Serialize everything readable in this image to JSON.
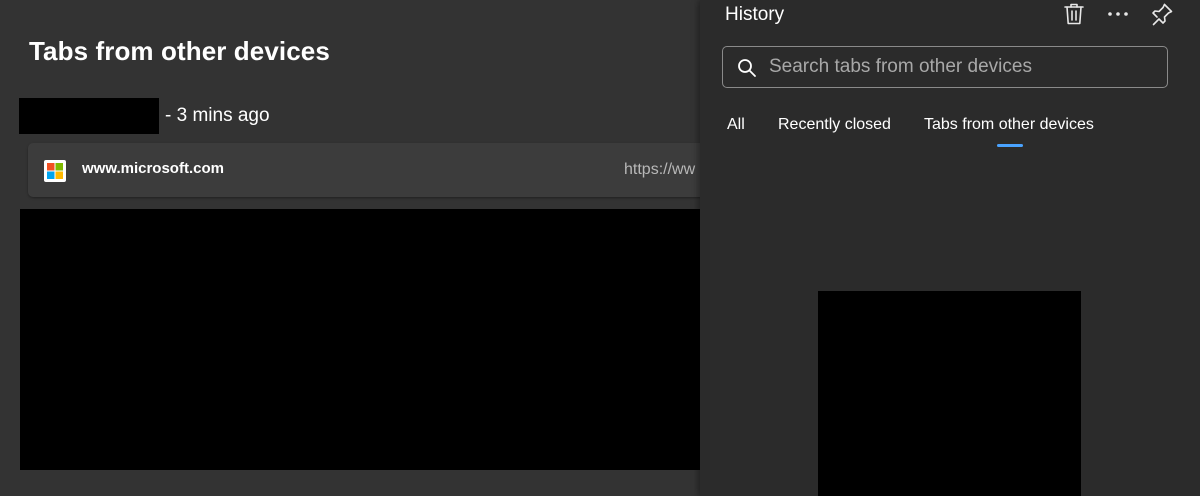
{
  "main": {
    "title": "Tabs from other devices",
    "device": {
      "time": "- 3 mins ago"
    },
    "tabs": [
      {
        "title": "www.microsoft.com",
        "url": "https://ww"
      }
    ]
  },
  "panel": {
    "title": "History",
    "search": {
      "placeholder": "Search tabs from other devices",
      "value": ""
    },
    "tabs": [
      {
        "label": "All"
      },
      {
        "label": "Recently closed"
      },
      {
        "label": "Tabs from other devices"
      }
    ],
    "icons": {
      "delete": "trash-icon",
      "more": "more-options-icon",
      "pin": "pin-icon"
    }
  },
  "colors": {
    "page_background": "#333333",
    "panel_background": "#2b2b2b",
    "card_background": "#3c3c3c",
    "accent": "#4aa3ff"
  }
}
